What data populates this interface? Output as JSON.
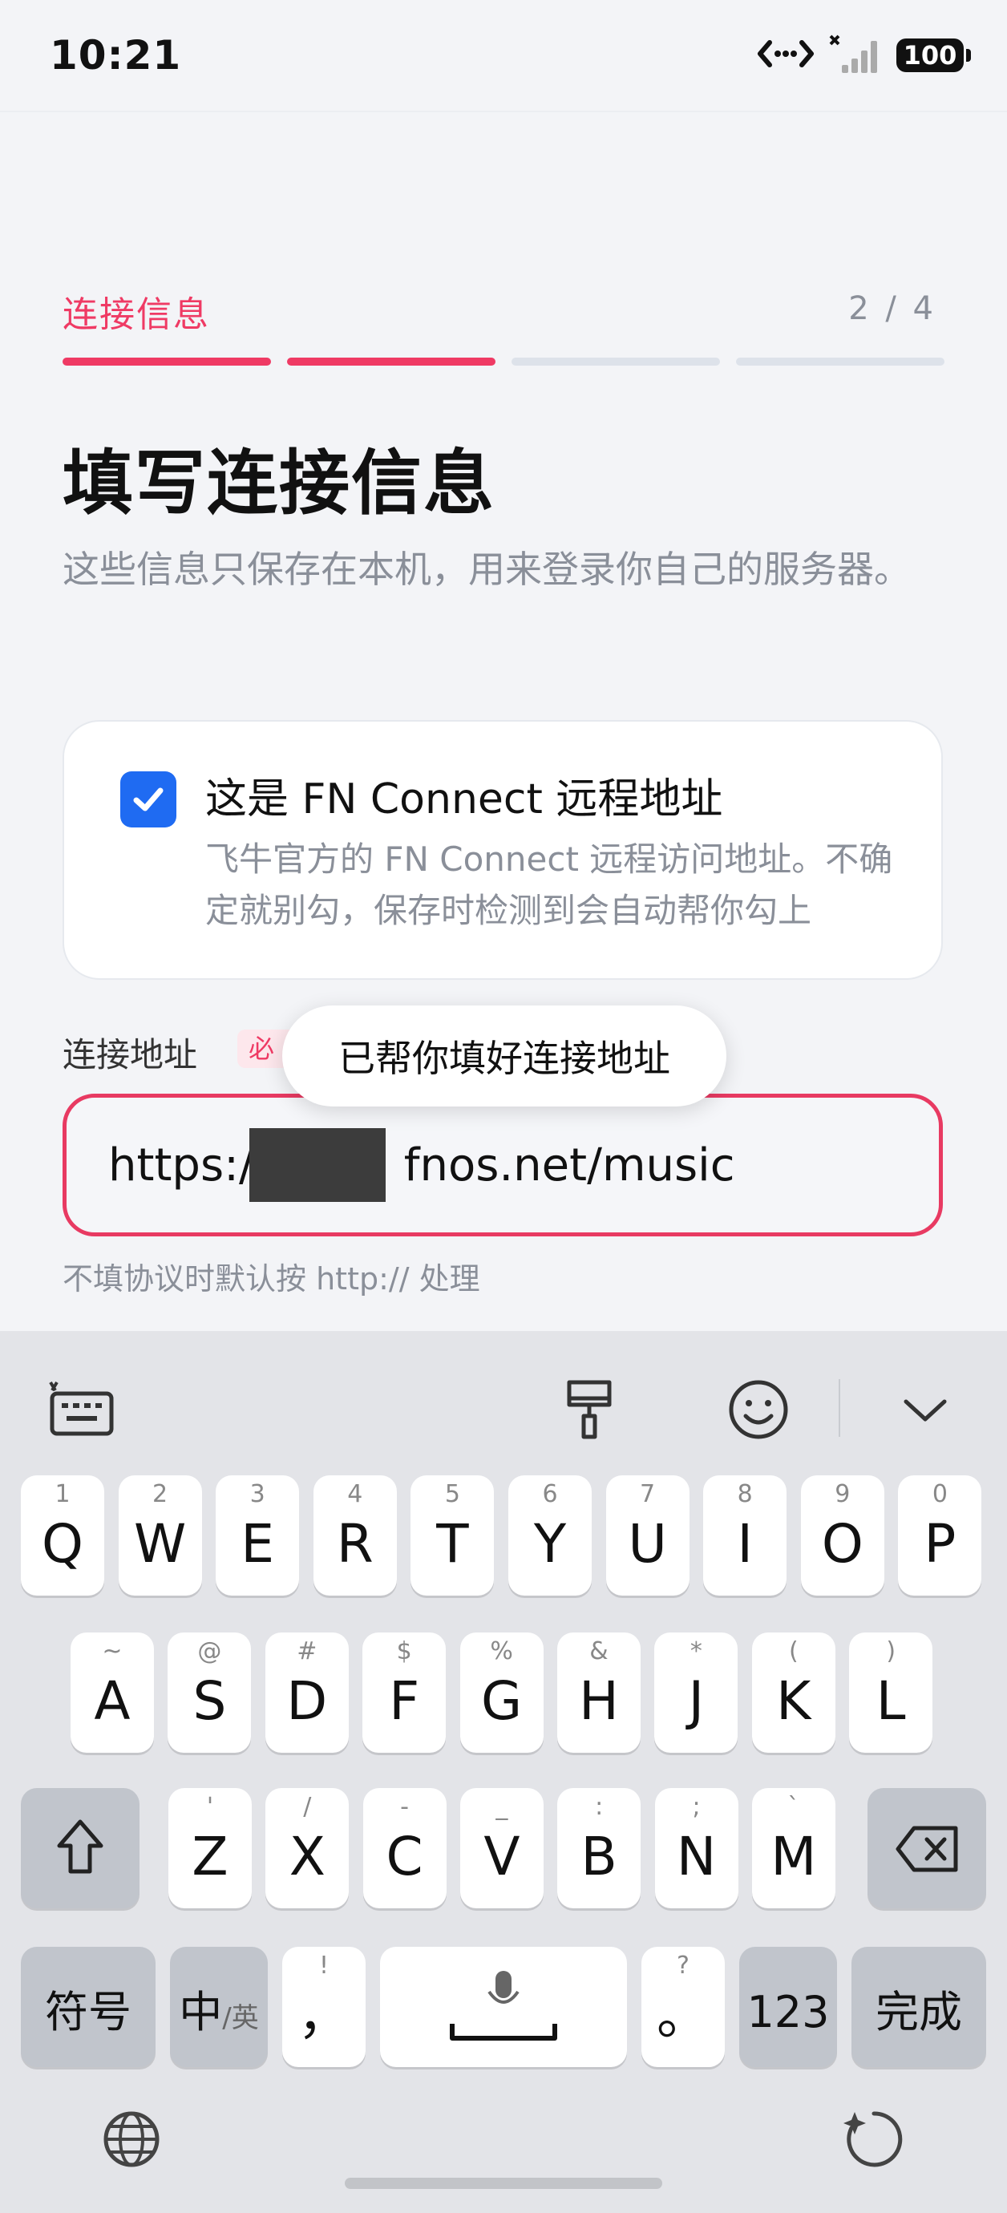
{
  "status": {
    "time": "10:21",
    "battery": "100"
  },
  "stepper": {
    "title": "连接信息",
    "count": "2 / 4"
  },
  "page": {
    "title": "填写连接信息",
    "subtitle": "这些信息只保存在本机，用来登录你自己的服务器。"
  },
  "remote_card": {
    "checked": true,
    "title": "这是 FN Connect 远程地址",
    "description": "飞牛官方的 FN Connect 远程访问地址。不确定就别勾，保存时检测到会自动帮你勾上"
  },
  "field": {
    "label": "连接地址",
    "required_badge": "必填",
    "value_prefix": "https://",
    "value_suffix": "fnos.net/music",
    "hint": "不填协议时默认按 http:// 处理"
  },
  "toast": "已帮你填好连接地址",
  "keyboard": {
    "row1": [
      {
        "k": "Q",
        "s": "1"
      },
      {
        "k": "W",
        "s": "2"
      },
      {
        "k": "E",
        "s": "3"
      },
      {
        "k": "R",
        "s": "4"
      },
      {
        "k": "T",
        "s": "5"
      },
      {
        "k": "Y",
        "s": "6"
      },
      {
        "k": "U",
        "s": "7"
      },
      {
        "k": "I",
        "s": "8"
      },
      {
        "k": "O",
        "s": "9"
      },
      {
        "k": "P",
        "s": "0"
      }
    ],
    "row2": [
      {
        "k": "A",
        "s": "~"
      },
      {
        "k": "S",
        "s": "@"
      },
      {
        "k": "D",
        "s": "#"
      },
      {
        "k": "F",
        "s": "$"
      },
      {
        "k": "G",
        "s": "%"
      },
      {
        "k": "H",
        "s": "&"
      },
      {
        "k": "J",
        "s": "*"
      },
      {
        "k": "K",
        "s": "("
      },
      {
        "k": "L",
        "s": ")"
      }
    ],
    "row3": [
      {
        "k": "Z",
        "s": "'"
      },
      {
        "k": "X",
        "s": "/"
      },
      {
        "k": "C",
        "s": "-"
      },
      {
        "k": "V",
        "s": "_"
      },
      {
        "k": "B",
        "s": ":"
      },
      {
        "k": "N",
        "s": ";"
      },
      {
        "k": "M",
        "s": "`"
      }
    ],
    "symbols_label": "符号",
    "lang_main": "中",
    "lang_sub": "/英",
    "comma": "，",
    "comma_sub": "!",
    "period": "。",
    "period_sub": "?",
    "numbers_label": "123",
    "done_label": "完成"
  }
}
